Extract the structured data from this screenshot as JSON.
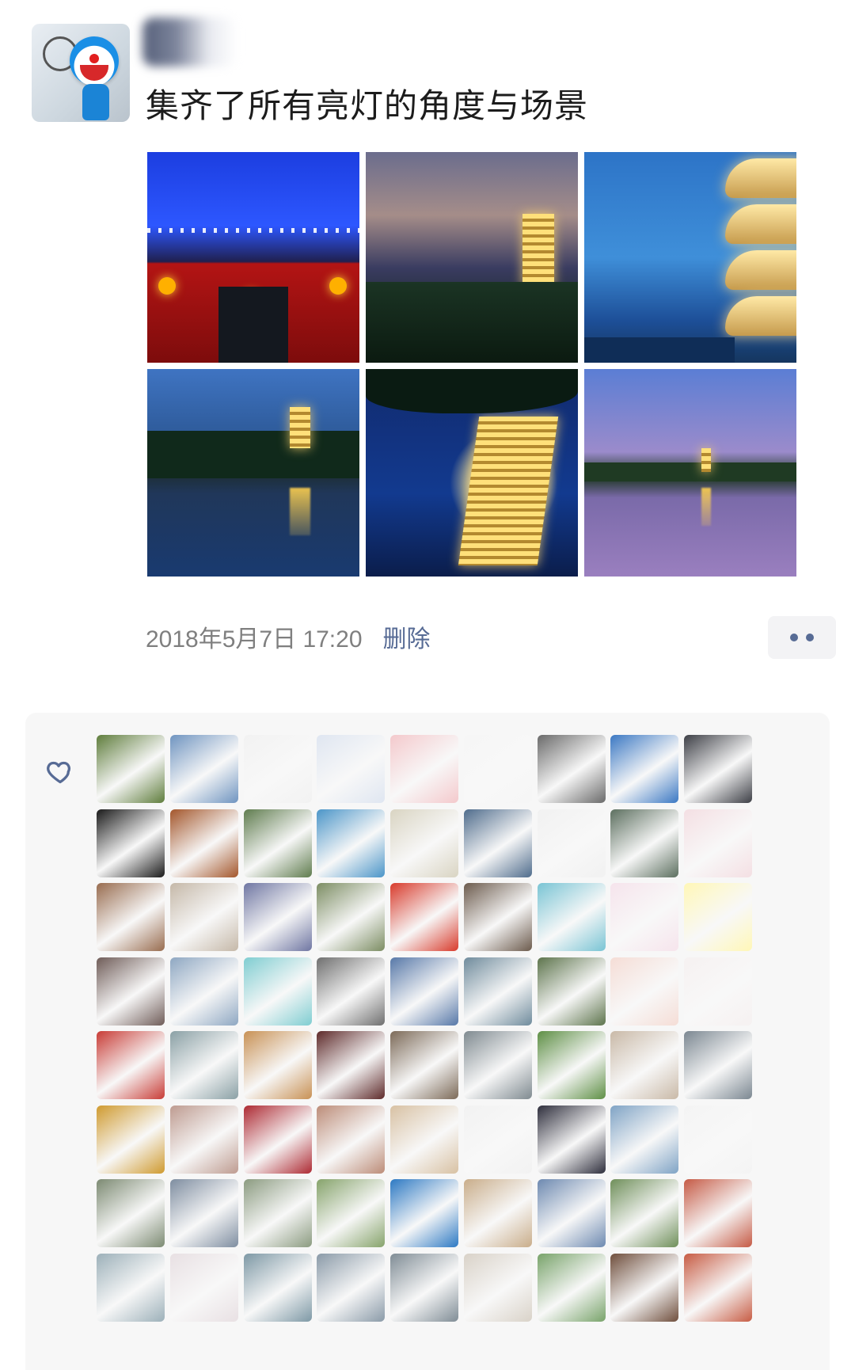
{
  "post": {
    "text": "集齐了所有亮灯的角度与场景",
    "timestamp": "2018年5月7日 17:20",
    "delete_label": "删除"
  },
  "photos": [
    {
      "name": "photo-gate-night"
    },
    {
      "name": "photo-pagoda-dusk"
    },
    {
      "name": "photo-pagoda-closeup"
    },
    {
      "name": "photo-lake-reflection"
    },
    {
      "name": "photo-pagoda-lowangle"
    },
    {
      "name": "photo-lake-purple"
    }
  ],
  "likes": {
    "icon": "heart-icon",
    "avatar_colors": [
      [
        "#5f7d3c",
        "#6f94c0",
        "#f2f2f2",
        "#dfe6f1",
        "#f4c9cc",
        "#f6f6f6",
        "#6a6a6a",
        "#3b78c3",
        "#3d3f46"
      ],
      [
        "#1a1a1a",
        "#a3562b",
        "#5f7c4e",
        "#4b95c8",
        "#d9d4c2",
        "#4f6c8c",
        "#f1f1f1",
        "#5c6f5f",
        "#f4dfe3"
      ],
      [
        "#986c4f",
        "#c5b8a8",
        "#6f76a2",
        "#7c8d63",
        "#d83b2c",
        "#6c5b4d",
        "#79c4d4",
        "#f6e4ec",
        "#fff7b7"
      ],
      [
        "#6f5c58",
        "#8ea7c2",
        "#7fcdd1",
        "#6f6f6f",
        "#5778a8",
        "#6f8b9c",
        "#5d744c",
        "#f5ddd6",
        "#f6f1f1"
      ],
      [
        "#c83c36",
        "#8aa0a5",
        "#c89155",
        "#5e2a2a",
        "#7c6a58",
        "#7f8a90",
        "#5e8f45",
        "#c9b9a7",
        "#7b8791"
      ],
      [
        "#cf9a2f",
        "#be9b90",
        "#ad2a33",
        "#bc8c78",
        "#d8c1a3",
        "#f2f2f2",
        "#2e2e3c",
        "#7fa3c5",
        "#f4f4f4"
      ],
      [
        "#7c8a72",
        "#7e8da0",
        "#8b9b80",
        "#86a36b",
        "#2d79c3",
        "#c9ad8a",
        "#6d89b0",
        "#6f8f5a",
        "#c55a45"
      ],
      [
        "#9cb0b9",
        "#e8e0e3",
        "#7d98a5",
        "#8a9aa8",
        "#7f8c95",
        "#d9d2c8",
        "#78a36a",
        "#6f4e3c",
        "#c75c44"
      ]
    ]
  }
}
